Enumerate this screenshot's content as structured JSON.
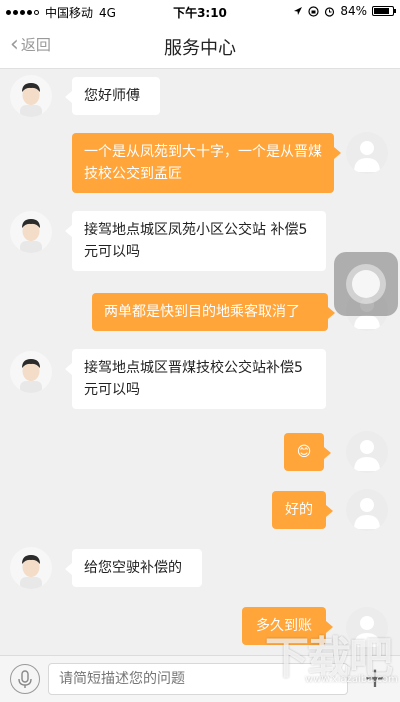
{
  "status_bar": {
    "carrier": "中国移动",
    "network": "4G",
    "time": "下午3:10",
    "battery_percent": 84,
    "battery_label": "84%"
  },
  "nav": {
    "back_label": "返回",
    "title": "服务中心"
  },
  "messages": [
    {
      "side": "in",
      "text": "您好师傅"
    },
    {
      "side": "out",
      "text": "一个是从凤苑到大十字，一个是从晋煤技校公交到孟匠"
    },
    {
      "side": "in",
      "text": "接驾地点城区凤苑小区公交站 补偿5元可以吗"
    },
    {
      "side": "out",
      "text": "两单都是快到目的地乘客取消了"
    },
    {
      "side": "in",
      "text": "接驾地点城区晋煤技校公交站补偿5元可以吗"
    },
    {
      "side": "out",
      "text": "😊"
    },
    {
      "side": "out",
      "text": "好的"
    },
    {
      "side": "in",
      "text": "给您空驶补偿的"
    },
    {
      "side": "out",
      "text": "多久到账"
    }
  ],
  "input": {
    "placeholder": "请简短描述您的问题"
  },
  "icons": {
    "back": "chevron-left-icon",
    "mic": "microphone-icon",
    "plus": "plus-icon",
    "assistive": "assistive-touch-icon"
  },
  "watermark": {
    "text": "下载吧",
    "url": "www.xiazaiba.com"
  },
  "colors": {
    "outgoing_bubble": "#ffa53a",
    "incoming_bubble": "#ffffff",
    "background": "#f0f0f0"
  }
}
